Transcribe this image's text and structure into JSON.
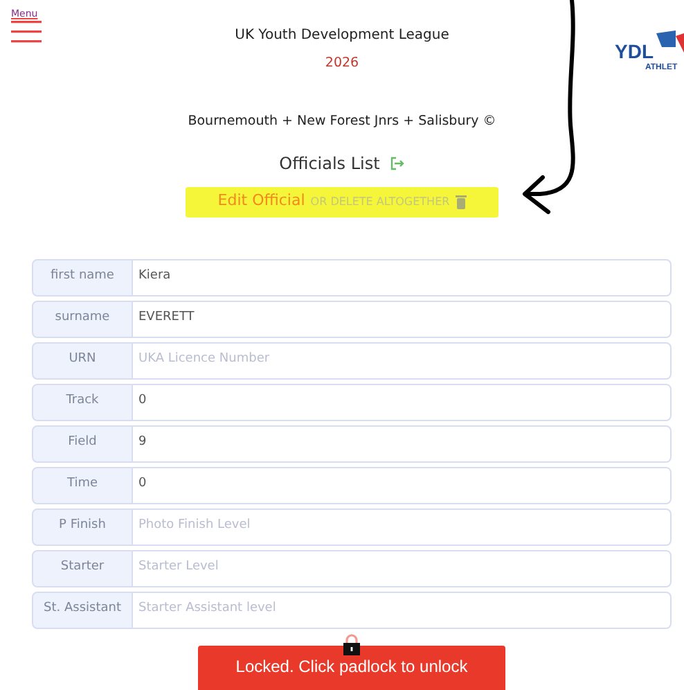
{
  "menu": {
    "label": "Menu"
  },
  "header": {
    "title": "UK Youth Development League",
    "year": "2026",
    "logo_text": "YDL",
    "logo_subtext": "ATHLET"
  },
  "club": {
    "name": "Bournemouth + New Forest Jnrs + Salisbury ©"
  },
  "list_link": {
    "label": "Officials List"
  },
  "edit_bar": {
    "title": "Edit Official",
    "delete_label": "OR DELETE ALTOGETHER"
  },
  "fields": [
    {
      "label": "first name",
      "value": "Kiera"
    },
    {
      "label": "surname",
      "value": "EVERETT"
    },
    {
      "label": "URN",
      "placeholder": "UKA Licence Number"
    },
    {
      "label": "Track",
      "value": "0"
    },
    {
      "label": "Field",
      "value": "9"
    },
    {
      "label": "Time",
      "value": "0"
    },
    {
      "label": "P Finish",
      "placeholder": "Photo Finish Level"
    },
    {
      "label": "Starter",
      "placeholder": "Starter Level"
    },
    {
      "label": "St. Assistant",
      "placeholder": "Starter Assistant level"
    }
  ],
  "lock_button": {
    "label": "Locked. Click padlock to unlock",
    "locked": true
  }
}
